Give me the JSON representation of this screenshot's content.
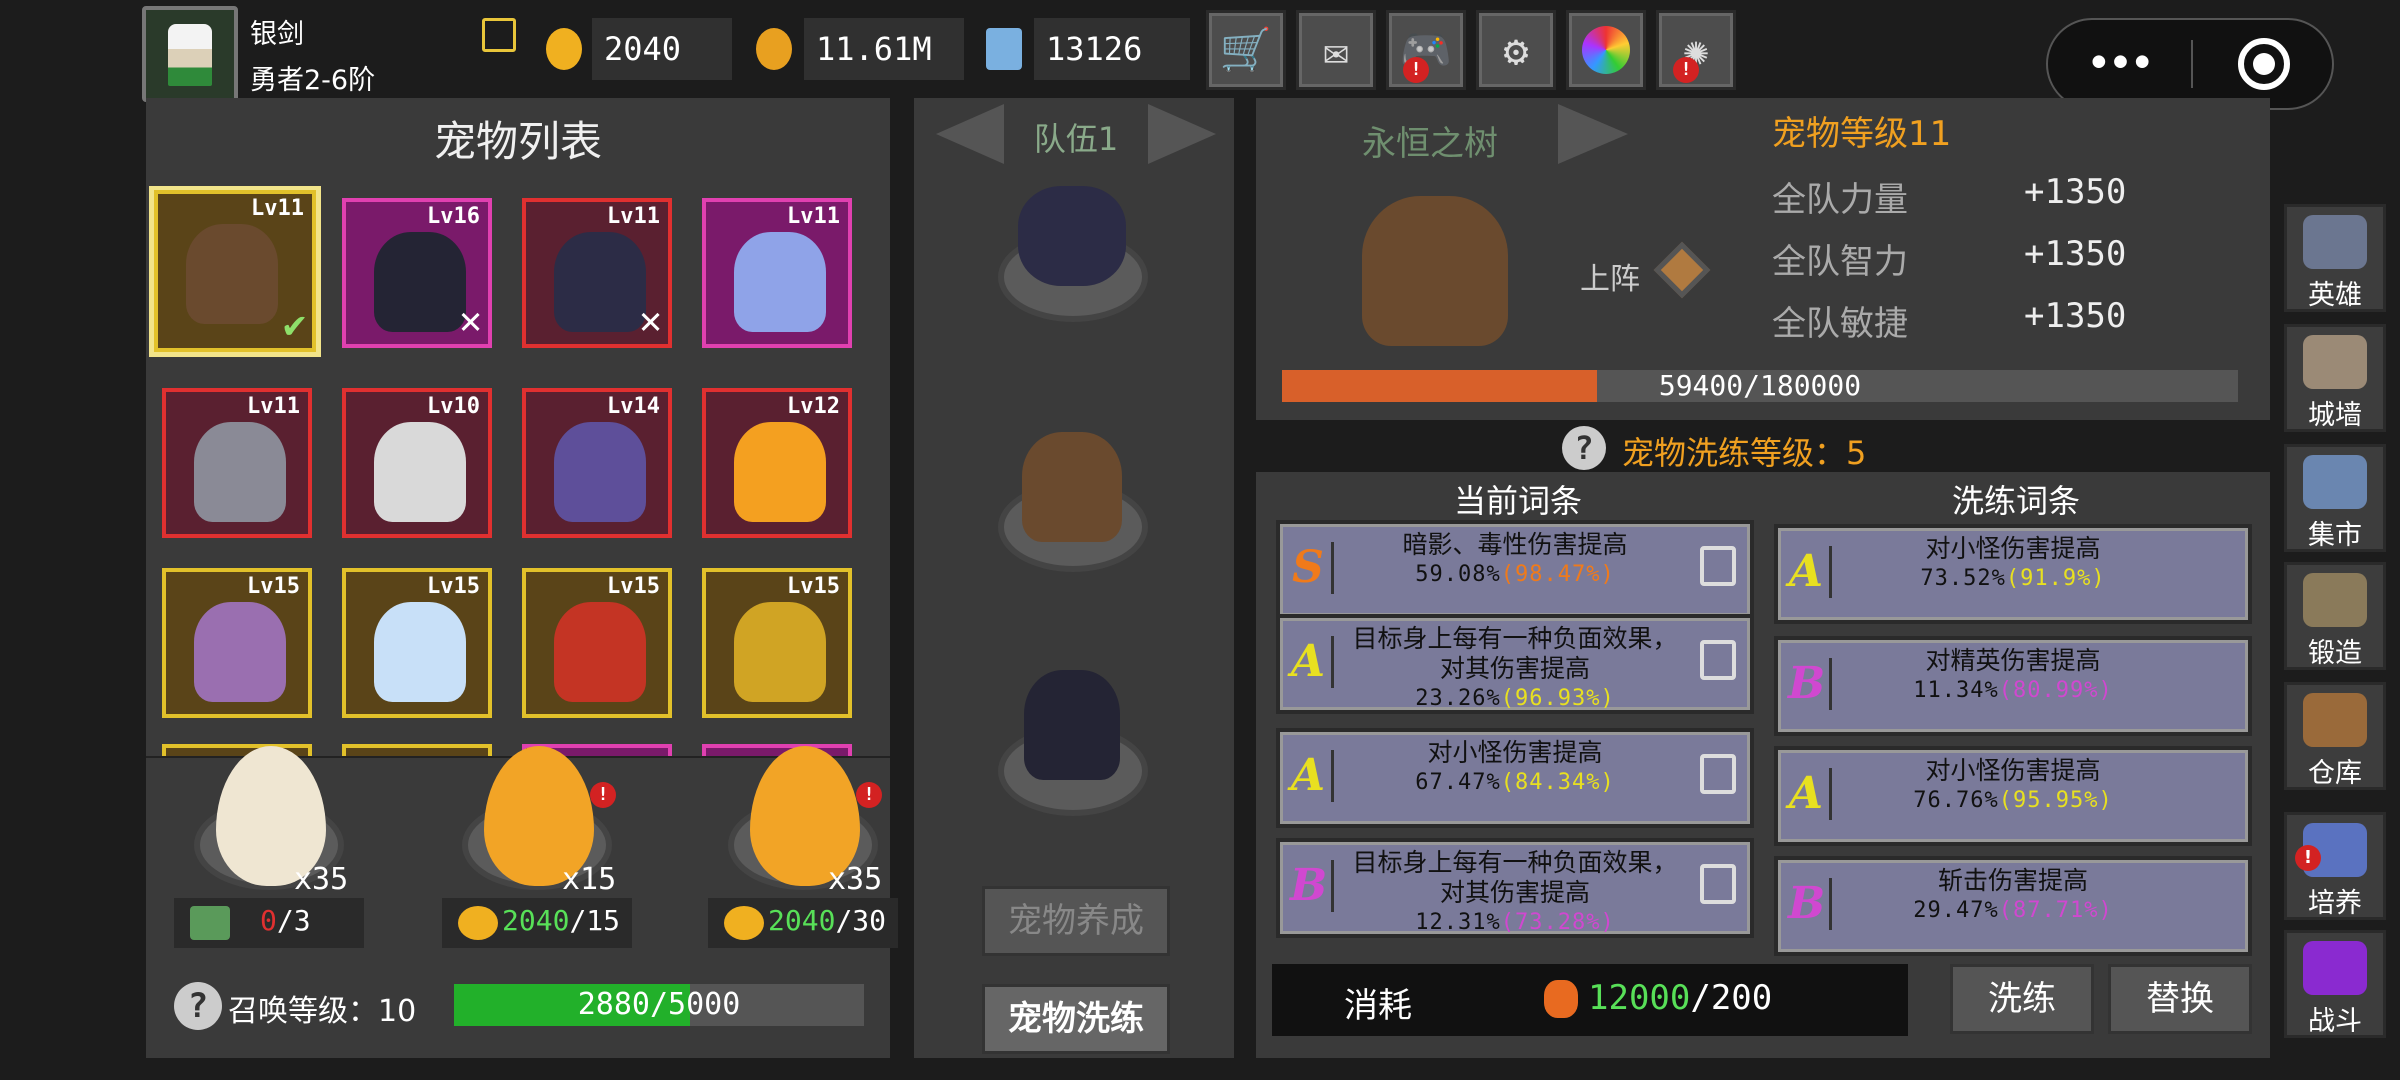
{
  "player": {
    "name": "银剑",
    "rank": "勇者2-6阶"
  },
  "resources": {
    "eggs": "2040",
    "coins": "11.61M",
    "gems": "13126"
  },
  "toolbar": [
    "cart-icon",
    "mail-icon",
    "gamepad-icon",
    "gear-icon",
    "color-wheel-icon",
    "firework-icon"
  ],
  "pet_list": {
    "title": "宠物列表",
    "pets": [
      {
        "level": "Lv11",
        "frame": "gold-selected",
        "color": "#6a4a2e",
        "status": "check"
      },
      {
        "level": "Lv16",
        "frame": "pink",
        "color": "#242434",
        "status": "x"
      },
      {
        "level": "Lv11",
        "frame": "red",
        "color": "#2c2c46",
        "status": "x"
      },
      {
        "level": "Lv11",
        "frame": "pink",
        "color": "#8fa3e8",
        "status": ""
      },
      {
        "level": "Lv11",
        "frame": "red",
        "color": "#8a8a96",
        "status": ""
      },
      {
        "level": "Lv10",
        "frame": "red",
        "color": "#d9d9d9",
        "status": ""
      },
      {
        "level": "Lv14",
        "frame": "red",
        "color": "#5e4f9a",
        "status": ""
      },
      {
        "level": "Lv12",
        "frame": "red",
        "color": "#f4a020",
        "status": ""
      },
      {
        "level": "Lv15",
        "frame": "gold",
        "color": "#9a6fb0",
        "status": ""
      },
      {
        "level": "Lv15",
        "frame": "gold",
        "color": "#c8e0f8",
        "status": ""
      },
      {
        "level": "Lv15",
        "frame": "gold",
        "color": "#c43424",
        "status": ""
      },
      {
        "level": "Lv15",
        "frame": "gold",
        "color": "#d0a424",
        "status": ""
      }
    ]
  },
  "summon": {
    "eggs": [
      {
        "count": "x35",
        "cost": "0",
        "max": "/3",
        "cost_color": "#e03030",
        "type": "ad"
      },
      {
        "count": "x15",
        "cost": "2040",
        "max": "/15",
        "cost_color": "#58e058",
        "type": "egg"
      },
      {
        "count": "x35",
        "cost": "2040",
        "max": "/30",
        "cost_color": "#58e058",
        "type": "egg"
      }
    ],
    "level_label": "召唤等级：10",
    "progress_text": "2880/5000",
    "progress": 0.576
  },
  "team": {
    "name": "队伍1",
    "btn_train": "宠物养成",
    "btn_wash": "宠物洗练"
  },
  "detail": {
    "pet_name": "永恒之树",
    "pet_level": "宠物等级11",
    "deploy": "上阵",
    "stats": [
      {
        "name": "全队力量",
        "value": "+1350"
      },
      {
        "name": "全队智力",
        "value": "+1350"
      },
      {
        "name": "全队敏捷",
        "value": "+1350"
      }
    ],
    "exp_text": "59400/180000",
    "exp": 0.33
  },
  "wash": {
    "level_label": "宠物洗练等级：5",
    "current_title": "当前词条",
    "new_title": "洗练词条",
    "current": [
      {
        "grade": "S",
        "grade_color": "#f07a1a",
        "line1": "暗影、毒性伤害提高",
        "line2": "",
        "pct": "59.08%",
        "sub": "(98.47%)",
        "sub_color": "#f07a1a"
      },
      {
        "grade": "A",
        "grade_color": "#e8e020",
        "line1": "目标身上每有一种负面效果，",
        "line2": "对其伤害提高",
        "pct": "23.26%",
        "sub": "(96.93%)",
        "sub_color": "#e8e020"
      },
      {
        "grade": "A",
        "grade_color": "#e8e020",
        "line1": "对小怪伤害提高",
        "line2": "",
        "pct": "67.47%",
        "sub": "(84.34%)",
        "sub_color": "#e8e020"
      },
      {
        "grade": "B",
        "grade_color": "#d048d0",
        "line1": "目标身上每有一种负面效果，",
        "line2": "对其伤害提高",
        "pct": "12.31%",
        "sub": "(73.28%)",
        "sub_color": "#d048d0"
      }
    ],
    "new": [
      {
        "grade": "A",
        "grade_color": "#e8e020",
        "line1": "对小怪伤害提高",
        "pct": "73.52%",
        "sub": "(91.9%)",
        "sub_color": "#e8e020"
      },
      {
        "grade": "B",
        "grade_color": "#d048d0",
        "line1": "对精英伤害提高",
        "pct": "11.34%",
        "sub": "(80.99%)",
        "sub_color": "#d048d0"
      },
      {
        "grade": "A",
        "grade_color": "#e8e020",
        "line1": "对小怪伤害提高",
        "pct": "76.76%",
        "sub": "(95.95%)",
        "sub_color": "#e8e020"
      },
      {
        "grade": "B",
        "grade_color": "#d048d0",
        "line1": "斩击伤害提高",
        "pct": "29.47%",
        "sub": "(87.71%)",
        "sub_color": "#d048d0"
      }
    ],
    "cost_label": "消耗",
    "cost_have": "12000",
    "cost_need": "/200",
    "btn_wash": "洗练",
    "btn_replace": "替换"
  },
  "side_nav": [
    {
      "label": "英雄",
      "icon": "helmet-icon",
      "color": "#6b7690",
      "badge": false
    },
    {
      "label": "城墙",
      "icon": "wall-icon",
      "color": "#9b8a76",
      "badge": false
    },
    {
      "label": "集市",
      "icon": "market-icon",
      "color": "#6a86b0",
      "badge": false
    },
    {
      "label": "锻造",
      "icon": "anvil-icon",
      "color": "#8a7a5a",
      "badge": false
    },
    {
      "label": "仓库",
      "icon": "warehouse-icon",
      "color": "#9a6a3a",
      "badge": false
    },
    {
      "label": "培养",
      "icon": "cultivate-icon",
      "color": "#5a72c0",
      "badge": true
    },
    {
      "label": "战斗",
      "icon": "portal-icon",
      "color": "#8a2ad0",
      "badge": false
    }
  ]
}
